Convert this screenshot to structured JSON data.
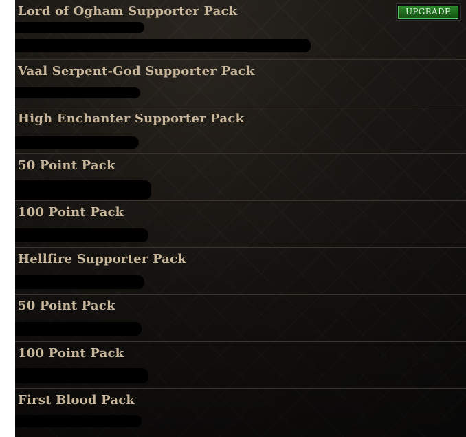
{
  "packs": [
    {
      "title": "Lord of Ogham Supporter Pack",
      "action_label": "UPGRADE"
    },
    {
      "title": "Vaal Serpent-God Supporter Pack"
    },
    {
      "title": "High Enchanter Supporter Pack"
    },
    {
      "title": "50 Point Pack"
    },
    {
      "title": "100 Point Pack"
    },
    {
      "title": "Hellfire Supporter Pack"
    },
    {
      "title": "50 Point Pack"
    },
    {
      "title": "100 Point Pack"
    },
    {
      "title": "First Blood Pack"
    }
  ],
  "colors": {
    "title_text": "#c8b69b",
    "background": "#1d1a16",
    "row_divider": "#3a342d",
    "upgrade_button": "#1c6a1c"
  }
}
